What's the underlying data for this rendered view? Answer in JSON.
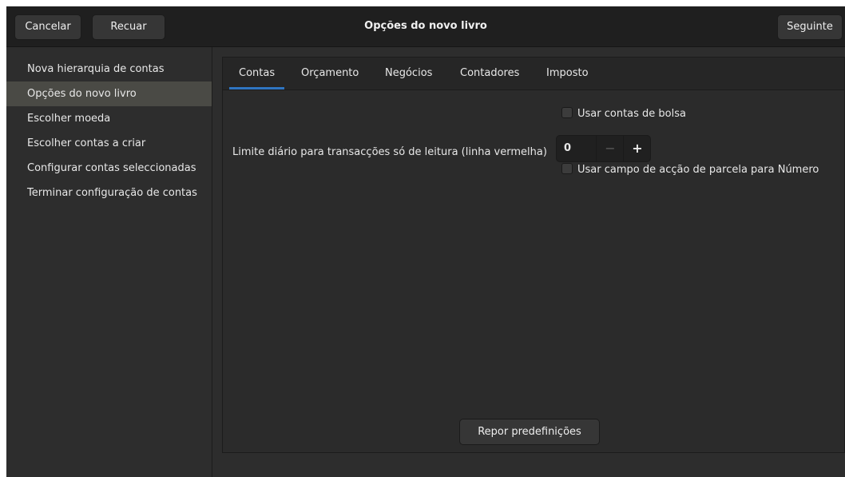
{
  "header": {
    "cancel_label": "Cancelar",
    "back_label": "Recuar",
    "title": "Opções do novo livro",
    "next_label": "Seguinte"
  },
  "sidebar": {
    "items": [
      {
        "label": "Nova hierarquia de contas",
        "selected": false
      },
      {
        "label": "Opções do novo livro",
        "selected": true
      },
      {
        "label": "Escolher moeda",
        "selected": false
      },
      {
        "label": "Escolher contas a criar",
        "selected": false
      },
      {
        "label": "Configurar contas seleccionadas",
        "selected": false
      },
      {
        "label": "Terminar configuração de contas",
        "selected": false
      }
    ]
  },
  "tabs": [
    {
      "label": "Contas",
      "active": true
    },
    {
      "label": "Orçamento",
      "active": false
    },
    {
      "label": "Negócios",
      "active": false
    },
    {
      "label": "Contadores",
      "active": false
    },
    {
      "label": "Imposto",
      "active": false
    }
  ],
  "options": {
    "trading_accounts_label": "Usar contas de bolsa",
    "trading_accounts_checked": false,
    "read_only_threshold_label": "Limite diário para transacções só de leitura (linha vermelha)",
    "read_only_threshold_value": "0",
    "split_action_label": "Usar campo de acção de parcela para Número",
    "split_action_checked": false
  },
  "spin": {
    "minus": "−",
    "plus": "+"
  },
  "reset_label": "Repor predefinições",
  "colors": {
    "accent": "#2f75c2",
    "background": "#2d2d2d",
    "headerbar": "#1f1f1f",
    "selected_row": "#4a4a45"
  }
}
